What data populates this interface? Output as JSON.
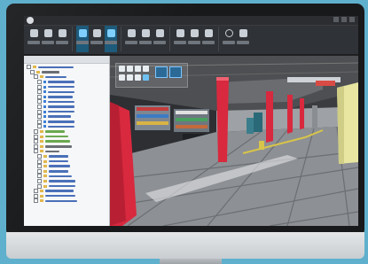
{
  "app": {
    "title": "",
    "window_controls": [
      "minimize-icon",
      "maximize-icon",
      "close-icon"
    ]
  },
  "toolbar": {
    "tools": [
      {
        "name": "select-tool",
        "icon": "cursor-icon"
      },
      {
        "name": "move-tool",
        "icon": "move-icon"
      },
      {
        "name": "view-tool",
        "icon": "camera-icon"
      },
      {
        "name": "layer-tool",
        "icon": "layers-icon"
      },
      {
        "name": "model-tool",
        "icon": "cube-icon"
      },
      {
        "name": "scene-tool",
        "icon": "scene-icon"
      },
      {
        "name": "edit-tool",
        "icon": "pencil-icon"
      },
      {
        "name": "home-tool",
        "icon": "home-icon"
      },
      {
        "name": "flag-tool",
        "icon": "flag-icon"
      },
      {
        "name": "location-tool",
        "icon": "pin-icon"
      },
      {
        "name": "network-tool",
        "icon": "network-icon"
      },
      {
        "name": "search-tool",
        "icon": "search-icon"
      },
      {
        "name": "settings-tool",
        "icon": "gear-icon"
      },
      {
        "name": "export-tool",
        "icon": "export-icon"
      }
    ]
  },
  "panel": {
    "title": ""
  },
  "colors": {
    "accent": "#1e5a7a",
    "pillar_red": "#d8293e",
    "pillar_yellow": "#e8e6a0",
    "floor_gray": "#8d9094"
  }
}
